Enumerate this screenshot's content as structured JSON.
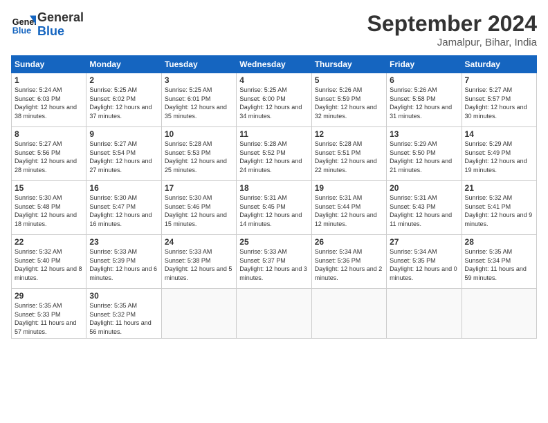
{
  "logo": {
    "line1": "General",
    "line2": "Blue"
  },
  "title": "September 2024",
  "location": "Jamalpur, Bihar, India",
  "weekdays": [
    "Sunday",
    "Monday",
    "Tuesday",
    "Wednesday",
    "Thursday",
    "Friday",
    "Saturday"
  ],
  "weeks": [
    [
      {
        "day": "1",
        "rise": "5:24 AM",
        "set": "6:03 PM",
        "daylight": "12 hours and 38 minutes."
      },
      {
        "day": "2",
        "rise": "5:25 AM",
        "set": "6:02 PM",
        "daylight": "12 hours and 37 minutes."
      },
      {
        "day": "3",
        "rise": "5:25 AM",
        "set": "6:01 PM",
        "daylight": "12 hours and 35 minutes."
      },
      {
        "day": "4",
        "rise": "5:25 AM",
        "set": "6:00 PM",
        "daylight": "12 hours and 34 minutes."
      },
      {
        "day": "5",
        "rise": "5:26 AM",
        "set": "5:59 PM",
        "daylight": "12 hours and 32 minutes."
      },
      {
        "day": "6",
        "rise": "5:26 AM",
        "set": "5:58 PM",
        "daylight": "12 hours and 31 minutes."
      },
      {
        "day": "7",
        "rise": "5:27 AM",
        "set": "5:57 PM",
        "daylight": "12 hours and 30 minutes."
      }
    ],
    [
      {
        "day": "8",
        "rise": "5:27 AM",
        "set": "5:56 PM",
        "daylight": "12 hours and 28 minutes."
      },
      {
        "day": "9",
        "rise": "5:27 AM",
        "set": "5:54 PM",
        "daylight": "12 hours and 27 minutes."
      },
      {
        "day": "10",
        "rise": "5:28 AM",
        "set": "5:53 PM",
        "daylight": "12 hours and 25 minutes."
      },
      {
        "day": "11",
        "rise": "5:28 AM",
        "set": "5:52 PM",
        "daylight": "12 hours and 24 minutes."
      },
      {
        "day": "12",
        "rise": "5:28 AM",
        "set": "5:51 PM",
        "daylight": "12 hours and 22 minutes."
      },
      {
        "day": "13",
        "rise": "5:29 AM",
        "set": "5:50 PM",
        "daylight": "12 hours and 21 minutes."
      },
      {
        "day": "14",
        "rise": "5:29 AM",
        "set": "5:49 PM",
        "daylight": "12 hours and 19 minutes."
      }
    ],
    [
      {
        "day": "15",
        "rise": "5:30 AM",
        "set": "5:48 PM",
        "daylight": "12 hours and 18 minutes."
      },
      {
        "day": "16",
        "rise": "5:30 AM",
        "set": "5:47 PM",
        "daylight": "12 hours and 16 minutes."
      },
      {
        "day": "17",
        "rise": "5:30 AM",
        "set": "5:46 PM",
        "daylight": "12 hours and 15 minutes."
      },
      {
        "day": "18",
        "rise": "5:31 AM",
        "set": "5:45 PM",
        "daylight": "12 hours and 14 minutes."
      },
      {
        "day": "19",
        "rise": "5:31 AM",
        "set": "5:44 PM",
        "daylight": "12 hours and 12 minutes."
      },
      {
        "day": "20",
        "rise": "5:31 AM",
        "set": "5:43 PM",
        "daylight": "12 hours and 11 minutes."
      },
      {
        "day": "21",
        "rise": "5:32 AM",
        "set": "5:41 PM",
        "daylight": "12 hours and 9 minutes."
      }
    ],
    [
      {
        "day": "22",
        "rise": "5:32 AM",
        "set": "5:40 PM",
        "daylight": "12 hours and 8 minutes."
      },
      {
        "day": "23",
        "rise": "5:33 AM",
        "set": "5:39 PM",
        "daylight": "12 hours and 6 minutes."
      },
      {
        "day": "24",
        "rise": "5:33 AM",
        "set": "5:38 PM",
        "daylight": "12 hours and 5 minutes."
      },
      {
        "day": "25",
        "rise": "5:33 AM",
        "set": "5:37 PM",
        "daylight": "12 hours and 3 minutes."
      },
      {
        "day": "26",
        "rise": "5:34 AM",
        "set": "5:36 PM",
        "daylight": "12 hours and 2 minutes."
      },
      {
        "day": "27",
        "rise": "5:34 AM",
        "set": "5:35 PM",
        "daylight": "12 hours and 0 minutes."
      },
      {
        "day": "28",
        "rise": "5:35 AM",
        "set": "5:34 PM",
        "daylight": "11 hours and 59 minutes."
      }
    ],
    [
      {
        "day": "29",
        "rise": "5:35 AM",
        "set": "5:33 PM",
        "daylight": "11 hours and 57 minutes."
      },
      {
        "day": "30",
        "rise": "5:35 AM",
        "set": "5:32 PM",
        "daylight": "11 hours and 56 minutes."
      },
      null,
      null,
      null,
      null,
      null
    ]
  ]
}
